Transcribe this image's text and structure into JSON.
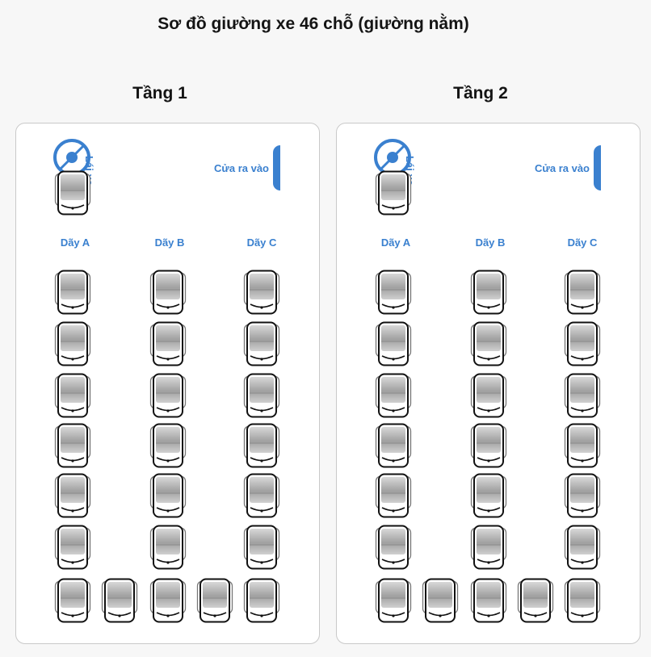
{
  "title": "Sơ đồ giường xe 46 chỗ (giường nằm)",
  "floors": [
    {
      "name": "Tầng 1",
      "driver_label": "Lái xe",
      "door_label": "Cửa ra vào",
      "rows": [
        "Dãy A",
        "Dãy B",
        "Dãy C"
      ]
    },
    {
      "name": "Tầng 2",
      "driver_label": "Lái xe",
      "door_label": "Cửa ra vào",
      "rows": [
        "Dãy A",
        "Dãy B",
        "Dãy C"
      ]
    }
  ],
  "colors": {
    "accent": "#3a80cf",
    "bed_outline": "#111111",
    "bed_fill": "#a8a8a8"
  }
}
